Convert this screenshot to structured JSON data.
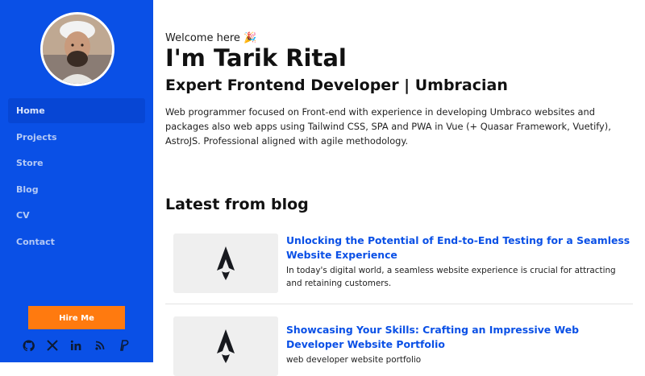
{
  "sidebar": {
    "nav": [
      {
        "label": "Home",
        "active": true
      },
      {
        "label": "Projects",
        "active": false
      },
      {
        "label": "Store",
        "active": false
      },
      {
        "label": "Blog",
        "active": false
      },
      {
        "label": "CV",
        "active": false
      },
      {
        "label": "Contact",
        "active": false
      }
    ],
    "hire_label": "Hire Me",
    "socials": [
      "github-icon",
      "x-icon",
      "linkedin-icon",
      "rss-icon",
      "paypal-icon"
    ]
  },
  "hero": {
    "welcome": "Welcome here 🎉",
    "name": "I'm Tarik Rital",
    "role": "Expert Frontend Developer | Umbracian",
    "intro": "Web programmer focused on Front-end with experience in developing Umbraco websites and packages also web apps using Tailwind CSS, SPA and PWA in Vue (+ Quasar Framework, Vuetify), AstroJS. Professional aligned with agile methodology."
  },
  "blog": {
    "heading": "Latest from blog",
    "posts": [
      {
        "title": "Unlocking the Potential of End-to-End Testing for a Seamless Website Experience",
        "excerpt": "In today's digital world, a seamless website experience is crucial for attracting and retaining customers.",
        "thumb_icon": "astro-logo-icon"
      },
      {
        "title": "Showcasing Your Skills: Crafting an Impressive Web Developer Website Portfolio",
        "excerpt": "web developer website portfolio",
        "thumb_icon": "astro-logo-icon"
      }
    ]
  },
  "colors": {
    "sidebar_bg": "#0a50e6",
    "accent": "#ff7a0f",
    "link": "#0a50e6"
  }
}
